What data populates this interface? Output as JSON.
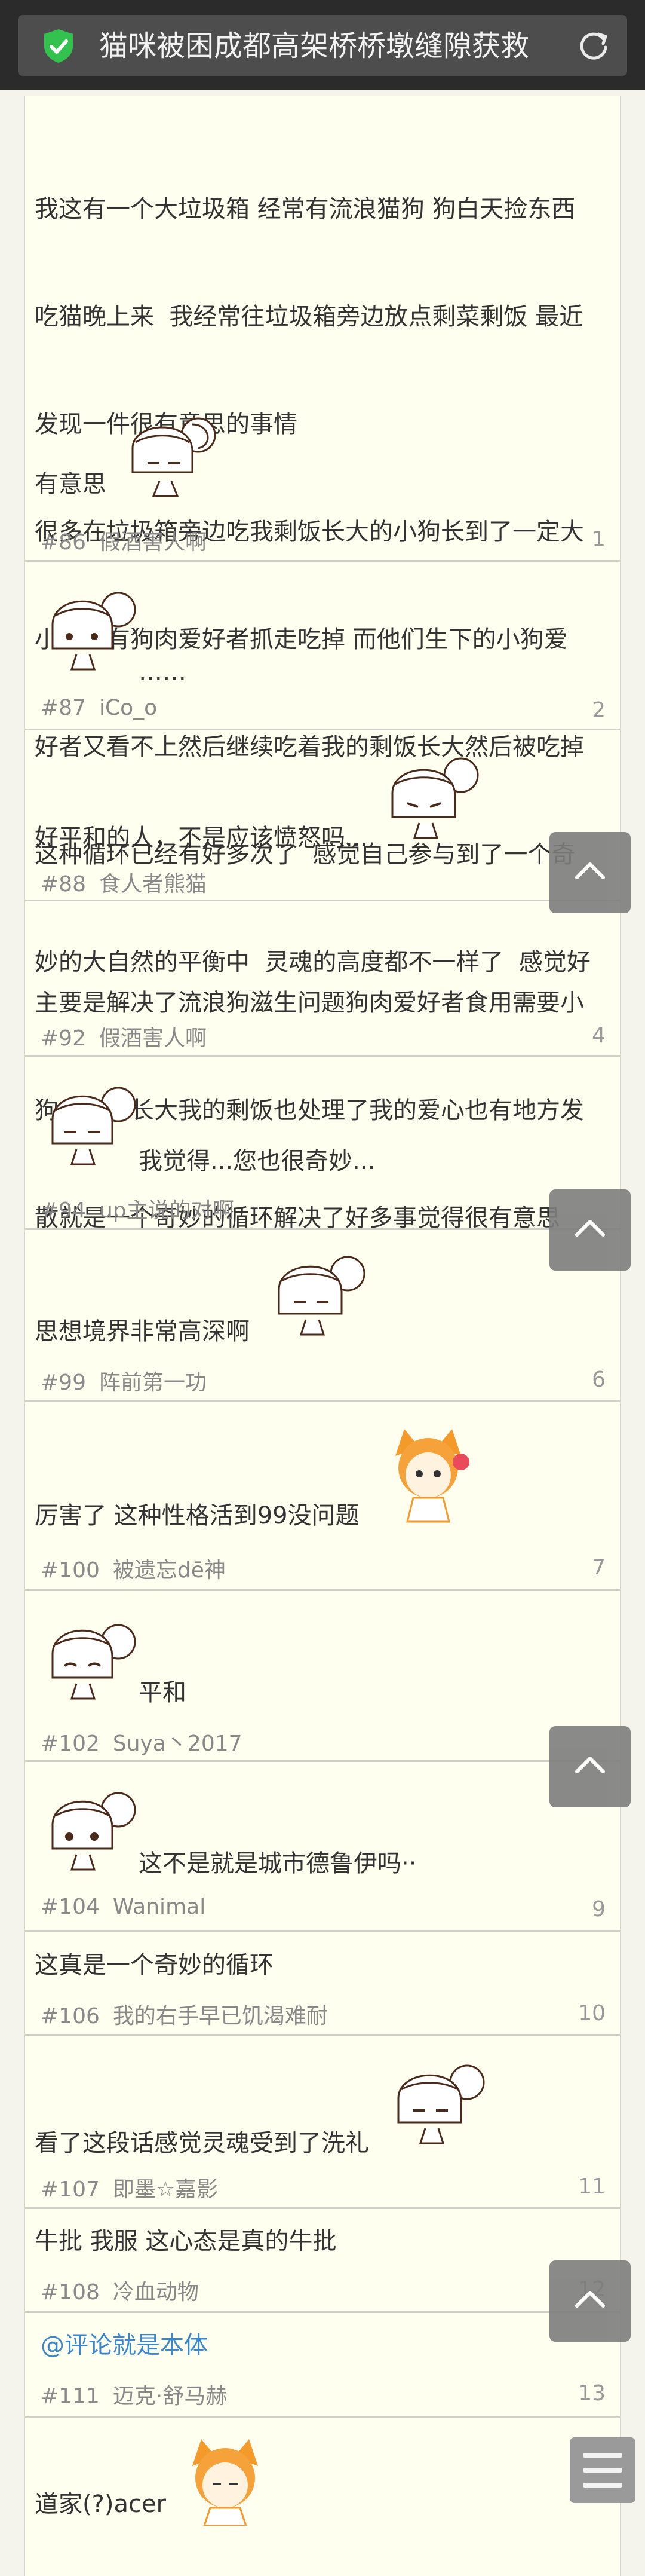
{
  "browser": {
    "title": "猫咪被困成都高架桥桥墩缝隙获救",
    "secure_icon": "green-shield-check-icon",
    "reload_icon": "reload-icon"
  },
  "posts": [
    {
      "lines": [
        "我这有一个大垃圾箱 经常有流浪猫狗 狗白天捡东西",
        "吃猫晚上来  我经常往垃圾箱旁边放点剩菜剩饭 最近",
        "发现一件很有意思的事情",
        "很多在垃圾箱旁边吃我剩饭长大的小狗长到了一定大",
        "小就会有狗肉爱好者抓走吃掉 而他们生下的小狗爱",
        "好者又看不上然后继续吃着我的剩饭长大然后被吃掉",
        "这种循环已经有好多次了  感觉自己参与到了一个奇",
        "妙的大自然的平衡中  灵魂的高度都不一样了  感觉好"
      ],
      "tail": "有意思",
      "num": "#86",
      "user": "假酒害人啊",
      "floor": "1"
    },
    {
      "text": "……",
      "num": "#87",
      "user": "iCo_o",
      "floor": "2"
    },
    {
      "text": "好平和的人，不是应该愤怒吗...",
      "num": "#88",
      "user": "食人者熊猫",
      "floor": ""
    },
    {
      "lines": [
        "主要是解决了流浪狗滋生问题狗肉爱好者食用需要小",
        "狗也能**长大我的剩饭也处理了我的爱心也有地方发",
        "散就是一个奇妙的循环解决了好多事觉得很有意思"
      ],
      "num": "#92",
      "user": "假酒害人啊",
      "floor": "4"
    },
    {
      "text": "我觉得...您也很奇妙...",
      "num": "#94",
      "user": "up主说的对啊",
      "floor": ""
    },
    {
      "text": "思想境界非常高深啊",
      "num": "#99",
      "user": "阵前第一功",
      "floor": "6"
    },
    {
      "text": "厉害了 这种性格活到99没问题",
      "num": "#100",
      "user": "被遗忘dē神",
      "floor": "7"
    },
    {
      "text": "平和",
      "num": "#102",
      "user": "Suya丶2017",
      "floor": ""
    },
    {
      "text": "这不是就是城市德鲁伊吗··",
      "num": "#104",
      "user": "Wanimal",
      "floor": "9"
    },
    {
      "text": "这真是一个奇妙的循环",
      "num": "#106",
      "user": "我的右手早已饥渴难耐",
      "floor": "10"
    },
    {
      "text": "看了这段话感觉灵魂受到了洗礼",
      "num": "#107",
      "user": "即墨☆嘉影",
      "floor": "11"
    },
    {
      "text": "牛批 我服 这心态是真的牛批",
      "num": "#108",
      "user": "冷血动物",
      "floor": "12"
    },
    {
      "text": "@评论就是本体",
      "num": "#111",
      "user": "迈克·舒马赫",
      "floor": "13"
    },
    {
      "text": "道家(?)acer",
      "num": "",
      "user": "",
      "floor": ""
    }
  ],
  "colors": {
    "page_bg": "#f4f4ec",
    "thread_bg": "#fffff0",
    "link": "#3a86c8",
    "meta": "#888888",
    "fab": "#7d7d7d"
  },
  "icons": {
    "scroll_up": "chevron-up-icon",
    "menu": "menu-icon"
  }
}
